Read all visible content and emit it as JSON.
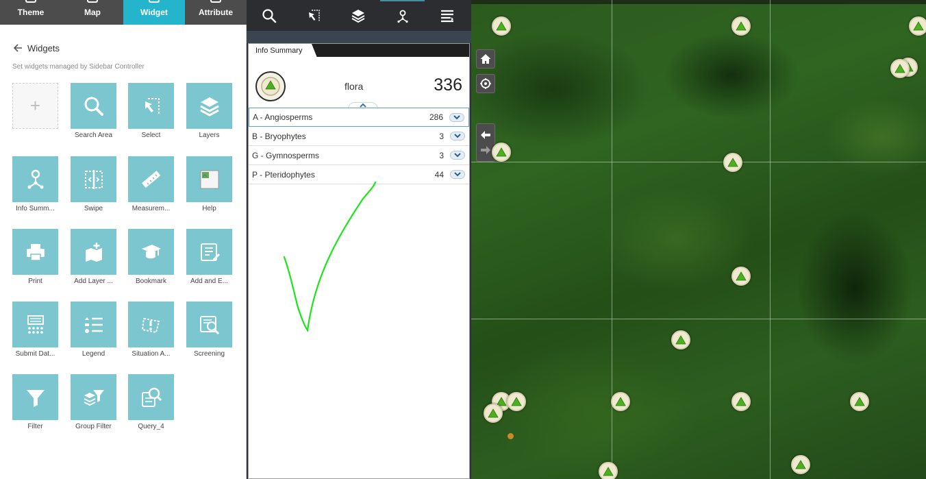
{
  "top_tabs": [
    {
      "label": "Theme",
      "active": false
    },
    {
      "label": "Map",
      "active": false
    },
    {
      "label": "Widget",
      "active": true
    },
    {
      "label": "Attribute",
      "active": false
    }
  ],
  "widgets_panel": {
    "title": "Widgets",
    "subtitle": "Set widgets managed by Sidebar Controller",
    "items": [
      {
        "label": "",
        "icon": "plus-icon"
      },
      {
        "label": "Search Area",
        "icon": "search-icon"
      },
      {
        "label": "Select",
        "icon": "select-icon"
      },
      {
        "label": "Layers",
        "icon": "layers-icon"
      },
      {
        "label": "Info Summ...",
        "icon": "info-summary-icon"
      },
      {
        "label": "Swipe",
        "icon": "swipe-icon"
      },
      {
        "label": "Measurem...",
        "icon": "ruler-icon"
      },
      {
        "label": "Help",
        "icon": "broken-image-icon"
      },
      {
        "label": "Print",
        "icon": "printer-icon"
      },
      {
        "label": "Add Layer ...",
        "icon": "add-layer-icon"
      },
      {
        "label": "Bookmark",
        "icon": "bookmark-icon"
      },
      {
        "label": "Add and E...",
        "icon": "edit-list-icon"
      },
      {
        "label": "Submit Dat...",
        "icon": "submit-data-icon"
      },
      {
        "label": "Legend",
        "icon": "legend-icon"
      },
      {
        "label": "Situation A...",
        "icon": "situation-awareness-icon"
      },
      {
        "label": "Screening",
        "icon": "screening-icon"
      },
      {
        "label": "Filter",
        "icon": "filter-icon"
      },
      {
        "label": "Group Filter",
        "icon": "group-filter-icon"
      },
      {
        "label": "Query_4",
        "icon": "query-icon"
      }
    ]
  },
  "app_toolbar": {
    "tools": [
      {
        "icon": "search-icon"
      },
      {
        "icon": "select-icon"
      },
      {
        "icon": "layers-icon"
      },
      {
        "icon": "info-summary-icon",
        "active": true
      },
      {
        "icon": "menu-icon"
      }
    ]
  },
  "info_summary": {
    "tab_label": "Info Summary",
    "layer_name": "flora",
    "total": "336",
    "rows": [
      {
        "label": "A - Angiosperms",
        "count": "286"
      },
      {
        "label": "B - Bryophytes",
        "count": "3"
      },
      {
        "label": "G - Gymnosperms",
        "count": "3"
      },
      {
        "label": "P - Pteridophytes",
        "count": "44"
      }
    ]
  },
  "map": {
    "controls": [
      "home-icon",
      "locate-icon",
      "back-arrow-icon",
      "forward-arrow-icon"
    ],
    "marker_color": "#4caf20",
    "annotation_color": "#19e619"
  },
  "colors": {
    "accent": "#24b5cc",
    "tile": "#7cc6cf",
    "dark_bar": "#4c4c4c"
  }
}
